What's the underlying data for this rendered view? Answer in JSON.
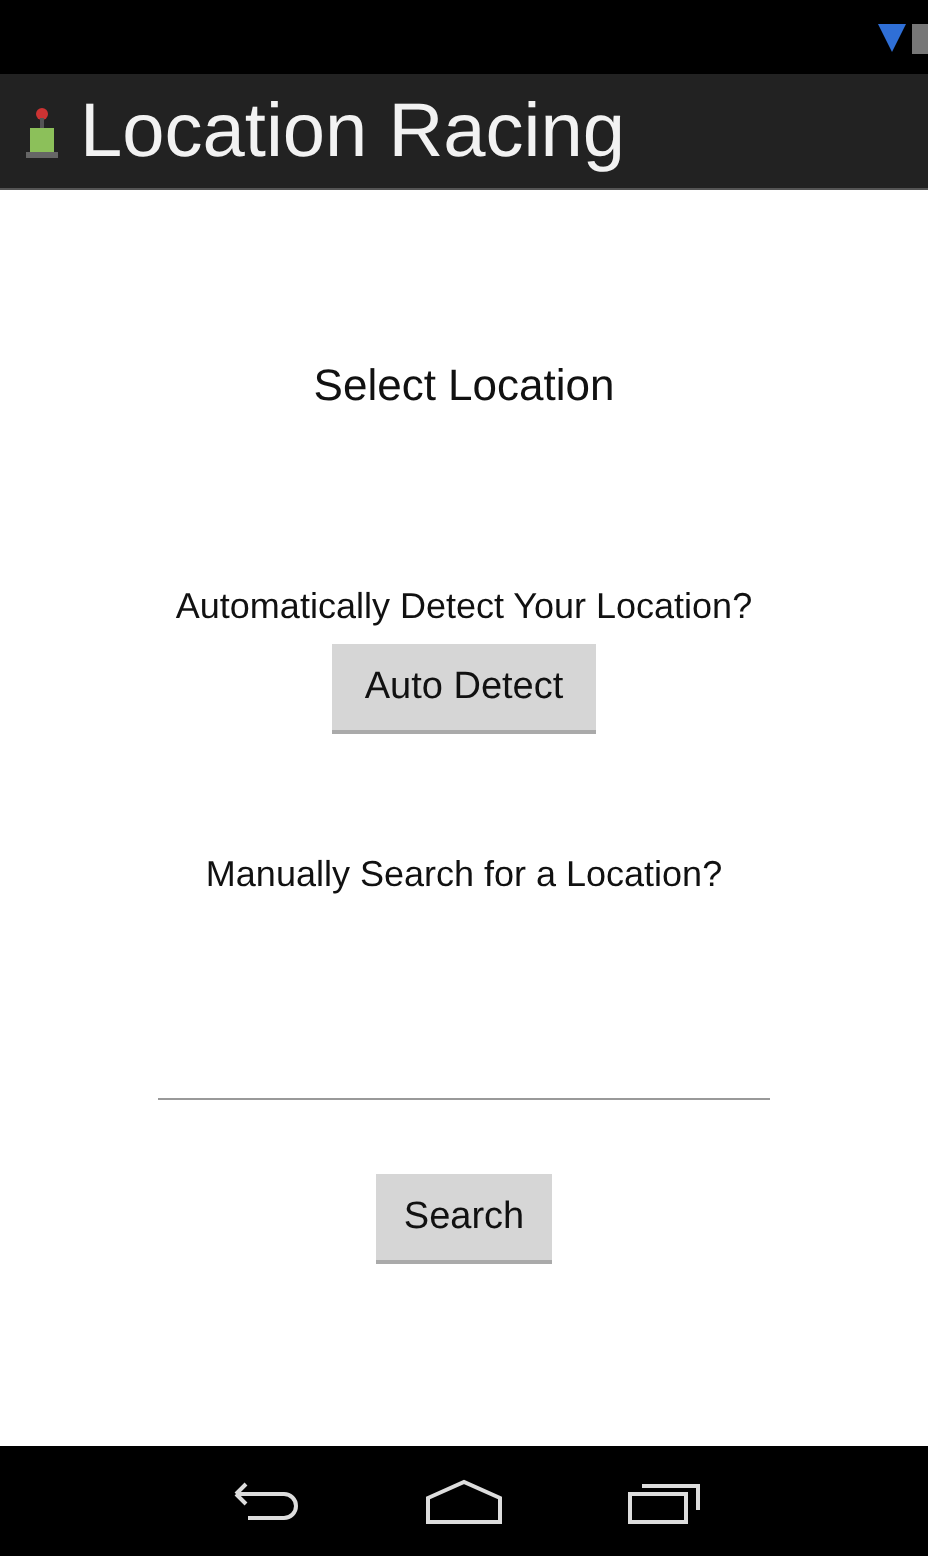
{
  "action_bar": {
    "title": "Location Racing"
  },
  "heading": "Select Location",
  "auto_prompt": "Automatically Detect Your Location?",
  "auto_button": "Auto Detect",
  "manual_prompt": "Manually Search for a Location?",
  "search_button": "Search"
}
